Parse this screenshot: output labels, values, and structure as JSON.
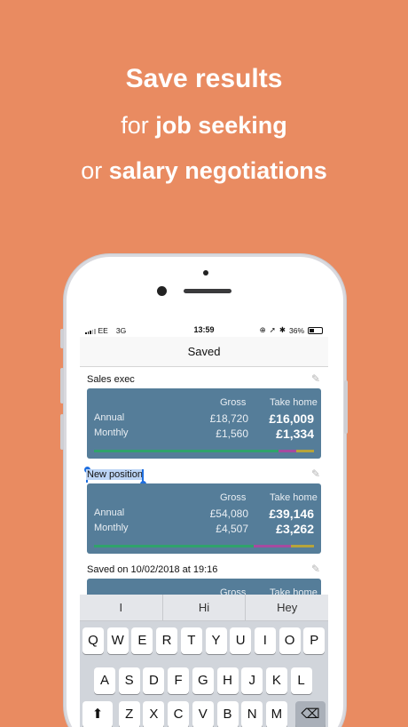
{
  "hero": {
    "line1": "Save results",
    "line2_pre": "for ",
    "line2_bold": "job seeking",
    "line3_pre": "or ",
    "line3_bold": "salary negotiations"
  },
  "status_bar": {
    "carrier": "EE",
    "network": "3G",
    "time": "13:59",
    "battery": "36%"
  },
  "nav": {
    "title": "Saved"
  },
  "columns": {
    "gross": "Gross",
    "take_home": "Take home"
  },
  "rows": {
    "annual": "Annual",
    "monthly": "Monthly"
  },
  "entries": [
    {
      "title": "Sales exec",
      "gross_annual": "£18,720",
      "gross_monthly": "£1,560",
      "take_annual": "£16,009",
      "take_monthly": "£1,334"
    },
    {
      "title": "New position",
      "gross_annual": "£54,080",
      "gross_monthly": "£4,507",
      "take_annual": "£39,146",
      "take_monthly": "£3,262"
    },
    {
      "title": "Saved on 10/02/2018 at 19:16"
    }
  ],
  "predictions": [
    "I",
    "Hi",
    "Hey"
  ],
  "keyboard": {
    "row1": [
      "Q",
      "W",
      "E",
      "R",
      "T",
      "Y",
      "U",
      "I",
      "O",
      "P"
    ],
    "row2": [
      "A",
      "S",
      "D",
      "F",
      "G",
      "H",
      "J",
      "K",
      "L"
    ],
    "row3": [
      "Z",
      "X",
      "C",
      "V",
      "B",
      "N",
      "M"
    ],
    "shift_icon": "shift-icon",
    "delete_icon": "backspace-icon"
  },
  "colors": {
    "background": "#E98B61",
    "card": "#557d99",
    "selection": "#bcd4f5"
  }
}
